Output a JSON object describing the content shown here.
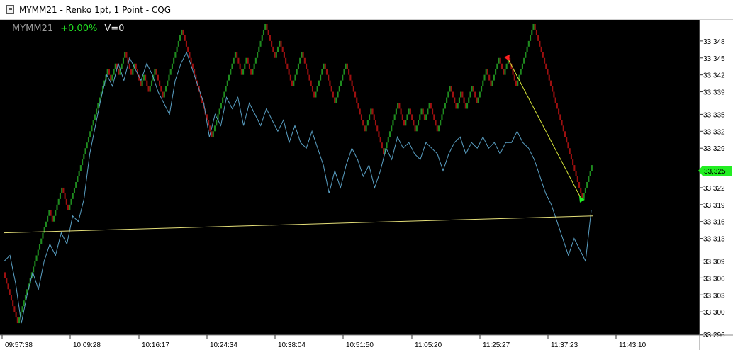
{
  "window": {
    "title": "MYMM21 - Renko 1pt, 1 Point - CQG"
  },
  "header": {
    "symbol": "MYMM21",
    "change": "+0.00%",
    "volume": "V=0"
  },
  "colors": {
    "up": "#1f8c1f",
    "down": "#9e1010",
    "line": "#5aa0c4",
    "trend": "#e6e07a",
    "arrow_line": "#d9e83a",
    "price_tag": "#22ee22",
    "axis_text": "#000000",
    "axis_bg": "#ffffff"
  },
  "chart_data": {
    "type": "renko",
    "brick_size": 1,
    "yticks": [
      33348,
      33345,
      33342,
      33339,
      33335,
      33332,
      33329,
      33325,
      33322,
      33319,
      33316,
      33313,
      33309,
      33306,
      33303,
      33300,
      33296
    ],
    "ytick_labels": [
      "33,348",
      "33,345",
      "33,342",
      "33,339",
      "33,335",
      "33,332",
      "33,329",
      "",
      "33,322",
      "33,319",
      "33,316",
      "33,313",
      "33,309",
      "33,306",
      "33,303",
      "33,300",
      "33,296"
    ],
    "ylim": [
      33296,
      33351.5
    ],
    "xticks": [
      "09:57:38",
      "10:09:28",
      "10:16:17",
      "10:24:34",
      "10:38:04",
      "10:51:50",
      "11:05:20",
      "11:25:27",
      "11:37:23",
      "11:43:10"
    ],
    "last_price_label": "33,325",
    "last_price": 33325,
    "renko_start": 33307,
    "renko_pivots": [
      33307,
      33298,
      33318,
      33316,
      33322,
      33318,
      33338,
      33343,
      33341,
      33344,
      33342,
      33346,
      33342,
      33344,
      33340,
      33342,
      33339,
      33343,
      33338,
      33345,
      33350,
      33339,
      33331,
      33346,
      33342,
      33345,
      33342,
      33351,
      33345,
      33348,
      33340,
      33346,
      33338,
      33344,
      33337,
      33344,
      33332,
      33336,
      33328,
      33337,
      33333,
      33336,
      33332,
      33336,
      33334,
      33337,
      33332,
      33340,
      33336,
      33339,
      33336,
      33340,
      33337,
      33343,
      33340,
      33345,
      33342,
      33345,
      33340,
      33346,
      33351,
      33320,
      33326
    ],
    "close_line": [
      33309,
      33310,
      33305,
      33298,
      33303,
      33307,
      33304,
      33309,
      33312,
      33310,
      33314,
      33312,
      33317,
      33316,
      33320,
      33328,
      33333,
      33338,
      33342,
      33340,
      33344,
      33341,
      33345,
      33343,
      33341,
      33344,
      33342,
      33339,
      33337,
      33335,
      33341,
      33344,
      33346,
      33343,
      33340,
      33337,
      33331,
      33335,
      33333,
      33338,
      33336,
      33338,
      33333,
      33337,
      33335,
      33333,
      33336,
      33334,
      33332,
      33334,
      33330,
      33333,
      33330,
      33329,
      33332,
      33329,
      33326,
      33321,
      33325,
      33322,
      33326,
      33329,
      33327,
      33324,
      33326,
      33322,
      33325,
      33329,
      33327,
      33331,
      33329,
      33330,
      33328,
      33327,
      33330,
      33329,
      33328,
      33325,
      33328,
      33330,
      33331,
      33328,
      33330,
      33329,
      33331,
      33329,
      33330,
      33328,
      33330,
      33330,
      33332,
      33330,
      33329,
      33327,
      33324,
      33321,
      33319,
      33316,
      33313,
      33310,
      33313,
      33311,
      33309,
      33318
    ],
    "trend_line": [
      33314,
      33317
    ],
    "arrow": {
      "from": 33345,
      "to": 33320
    },
    "grid": false
  }
}
